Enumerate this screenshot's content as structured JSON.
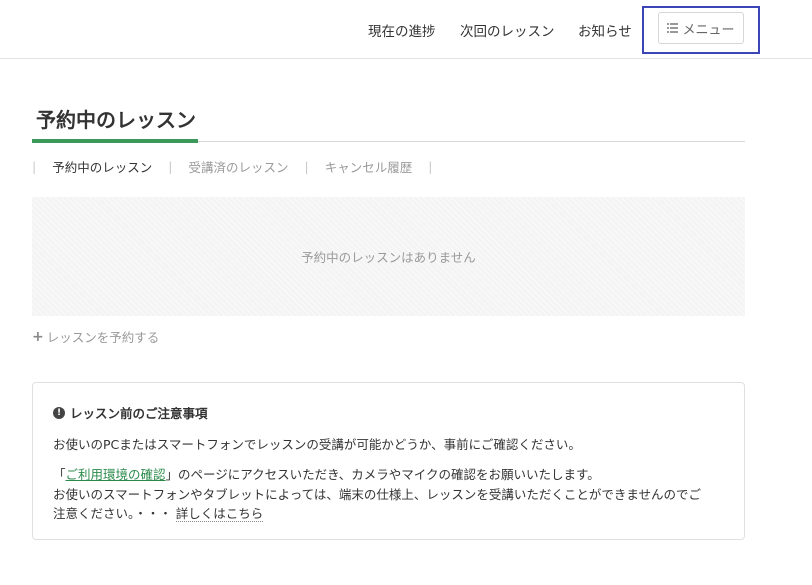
{
  "header": {
    "nav": {
      "progress": "現在の進捗",
      "next_lesson": "次回のレッスン",
      "news": "お知らせ",
      "menu": "メニュー"
    }
  },
  "main": {
    "page_title": "予約中のレッスン",
    "tabs": [
      "予約中のレッスン",
      "受講済のレッスン",
      "キャンセル履歴"
    ],
    "empty_message": "予約中のレッスンはありません",
    "add_lesson": "レッスンを予約する"
  },
  "notice": {
    "title": "レッスン前のご注意事項",
    "line1": "お使いのPCまたはスマートフォンでレッスンの受講が可能かどうか、事前にご確認ください。",
    "line2_prefix": "「",
    "line2_link": "ご利用環境の確認",
    "line2_suffix": "」のページにアクセスいただき、カメラやマイクの確認をお願いいたします。",
    "line3": "お使いのスマートフォンやタブレットによっては、端末の仕様上、レッスンを受講いただくことができませんのでご",
    "line4": "注意ください。・・・",
    "details_link": "詳しくはこちら"
  },
  "colors": {
    "accent_green": "#3b9a5a",
    "highlight_blue": "#3b45b8"
  }
}
